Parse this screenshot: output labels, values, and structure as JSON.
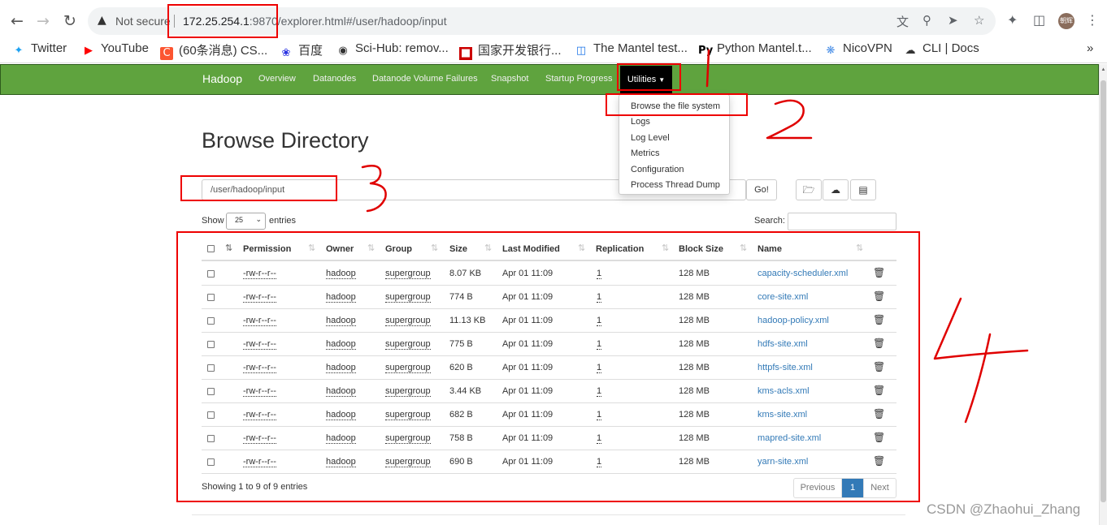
{
  "browser": {
    "security_label": "Not secure",
    "url_host": "172.25.254.1",
    "url_rest": ":9870/explorer.html#/user/hadoop/input",
    "avatar_text": "朝辉",
    "bookmarks": [
      {
        "label": "Twitter",
        "icon": "twitter-bird-icon"
      },
      {
        "label": "YouTube",
        "icon": "youtube-play-icon"
      },
      {
        "label": "(60条消息) CS...",
        "icon": "csdn-c-icon"
      },
      {
        "label": "百度",
        "icon": "baidu-paw-icon"
      },
      {
        "label": "Sci-Hub: remov...",
        "icon": "scihub-icon"
      },
      {
        "label": "国家开发银行...",
        "icon": "cdb-icon"
      },
      {
        "label": "The Mantel test...",
        "icon": "page-icon"
      },
      {
        "label": "Python Mantel.t...",
        "icon": "python-py-icon"
      },
      {
        "label": "NicoVPN",
        "icon": "nicovpn-icon"
      },
      {
        "label": "CLI | Docs",
        "icon": "cloud-icon"
      }
    ],
    "more_bookmarks": "»"
  },
  "navbar": {
    "brand": "Hadoop",
    "items": [
      "Overview",
      "Datanodes",
      "Datanode Volume Failures",
      "Snapshot",
      "Startup Progress"
    ],
    "utilities_label": "Utilities",
    "bg_color": "#5fa33e"
  },
  "dropdown": {
    "items": [
      "Browse the file system",
      "Logs",
      "Log Level",
      "Metrics",
      "Configuration",
      "Process Thread Dump"
    ]
  },
  "page": {
    "title": "Browse Directory",
    "path_value": "/user/hadoop/input",
    "go_label": "Go!",
    "show_label": "Show",
    "show_value": "25",
    "entries_label": "entries",
    "search_label": "Search:"
  },
  "table": {
    "columns": [
      "Permission",
      "Owner",
      "Group",
      "Size",
      "Last Modified",
      "Replication",
      "Block Size",
      "Name"
    ],
    "rows": [
      [
        "-rw-r--r--",
        "hadoop",
        "supergroup",
        "8.07 KB",
        "Apr 01 11:09",
        "1",
        "128 MB",
        "capacity-scheduler.xml"
      ],
      [
        "-rw-r--r--",
        "hadoop",
        "supergroup",
        "774 B",
        "Apr 01 11:09",
        "1",
        "128 MB",
        "core-site.xml"
      ],
      [
        "-rw-r--r--",
        "hadoop",
        "supergroup",
        "11.13 KB",
        "Apr 01 11:09",
        "1",
        "128 MB",
        "hadoop-policy.xml"
      ],
      [
        "-rw-r--r--",
        "hadoop",
        "supergroup",
        "775 B",
        "Apr 01 11:09",
        "1",
        "128 MB",
        "hdfs-site.xml"
      ],
      [
        "-rw-r--r--",
        "hadoop",
        "supergroup",
        "620 B",
        "Apr 01 11:09",
        "1",
        "128 MB",
        "httpfs-site.xml"
      ],
      [
        "-rw-r--r--",
        "hadoop",
        "supergroup",
        "3.44 KB",
        "Apr 01 11:09",
        "1",
        "128 MB",
        "kms-acls.xml"
      ],
      [
        "-rw-r--r--",
        "hadoop",
        "supergroup",
        "682 B",
        "Apr 01 11:09",
        "1",
        "128 MB",
        "kms-site.xml"
      ],
      [
        "-rw-r--r--",
        "hadoop",
        "supergroup",
        "758 B",
        "Apr 01 11:09",
        "1",
        "128 MB",
        "mapred-site.xml"
      ],
      [
        "-rw-r--r--",
        "hadoop",
        "supergroup",
        "690 B",
        "Apr 01 11:09",
        "1",
        "128 MB",
        "yarn-site.xml"
      ]
    ]
  },
  "footer": {
    "showing": "Showing 1 to 9 of 9 entries",
    "previous": "Previous",
    "page": "1",
    "next": "Next"
  },
  "annotations": {
    "marks": [
      "1",
      "2",
      "3",
      "4"
    ],
    "color": "#e00000"
  },
  "watermark": "CSDN @Zhaohui_Zhang"
}
